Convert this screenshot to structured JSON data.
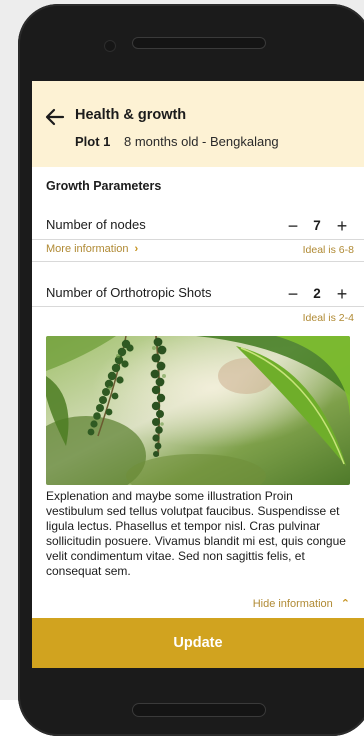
{
  "header": {
    "title": "Health & growth",
    "plot_name": "Plot 1",
    "plot_info": "8 months old - Bengkalang",
    "background_color": "#fdf2d4"
  },
  "section": {
    "title": "Growth Parameters"
  },
  "params": [
    {
      "label": "Number of nodes",
      "value": "7",
      "ideal": "Ideal is 6-8",
      "more_info_label": "More information"
    },
    {
      "label": "Number of Orthotropic Shots",
      "value": "2",
      "ideal": "Ideal is 2-4"
    }
  ],
  "explanation": "Explenation and maybe some illustration Proin vestibulum sed tellus volutpat faucibus. Suspendisse et ligula lectus. Phasellus et tempor nisl. Cras pulvinar sollicitudin posuere. Vivamus blandit mi est, quis congue velit condimentum vitae. Sed non sagittis felis, et consequat sem.",
  "hide_info_label": "Hide information",
  "update_label": "Update",
  "icons": {
    "back": "arrow-left-icon",
    "minus": "minus-icon",
    "plus": "plus-icon",
    "chevron_right": "chevron-right-icon",
    "chevron_up": "chevron-up-icon"
  },
  "colors": {
    "accent": "#d1a31f",
    "link": "#b08a34"
  }
}
